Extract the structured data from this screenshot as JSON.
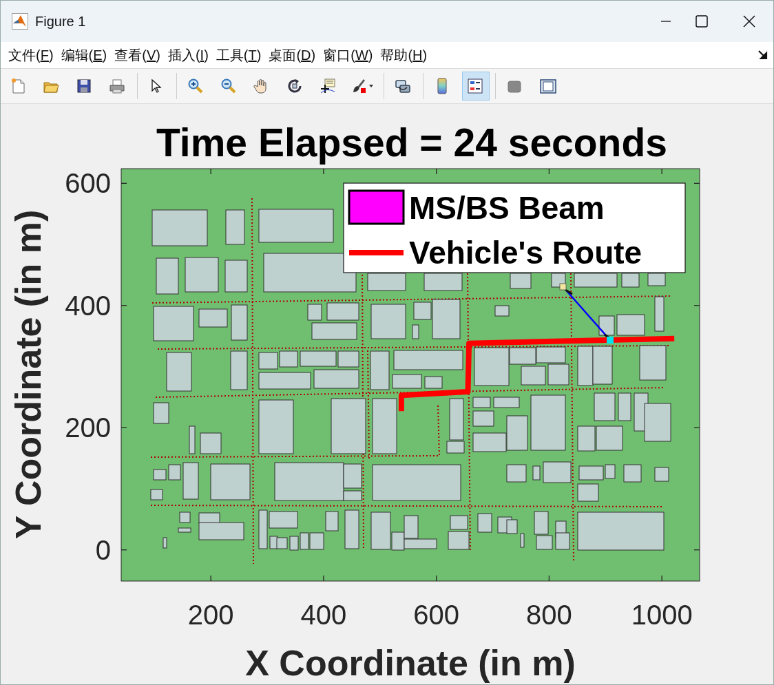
{
  "window": {
    "title": "Figure 1"
  },
  "menu": [
    {
      "label": "文件(F)"
    },
    {
      "label": "编辑(E)"
    },
    {
      "label": "查看(V)"
    },
    {
      "label": "插入(I)"
    },
    {
      "label": "工具(T)"
    },
    {
      "label": "桌面(D)"
    },
    {
      "label": "窗口(W)"
    },
    {
      "label": "帮助(H)"
    }
  ],
  "toolbar": [
    {
      "kind": "new",
      "selected": false
    },
    {
      "kind": "open",
      "selected": false
    },
    {
      "kind": "save",
      "selected": false
    },
    {
      "kind": "print",
      "selected": false
    },
    {
      "kind": "separator"
    },
    {
      "kind": "pointer",
      "selected": false
    },
    {
      "kind": "separator"
    },
    {
      "kind": "zoom-in",
      "selected": false
    },
    {
      "kind": "zoom-out",
      "selected": false
    },
    {
      "kind": "pan",
      "selected": false
    },
    {
      "kind": "rotate",
      "selected": false
    },
    {
      "kind": "data-cursor",
      "selected": false
    },
    {
      "kind": "brush",
      "selected": false
    },
    {
      "kind": "separator"
    },
    {
      "kind": "link",
      "selected": false
    },
    {
      "kind": "separator"
    },
    {
      "kind": "colorbar",
      "selected": false
    },
    {
      "kind": "legend",
      "selected": true
    },
    {
      "kind": "separator"
    },
    {
      "kind": "square",
      "selected": false
    },
    {
      "kind": "frame",
      "selected": false
    }
  ],
  "figure": {
    "legend": [
      {
        "label": "MS/BS Beam",
        "kind": "patch",
        "color": "#ff00ff"
      }
    ],
    "chart_data": {
      "type": "line",
      "title": "Time Elapsed = 24 seconds",
      "xlabel": "X Coordinate (in m)",
      "ylabel": "Y Coordinate (in m)",
      "xlim": [
        41,
        1067
      ],
      "ylim": [
        -51,
        624
      ],
      "xticks": [
        200,
        400,
        600,
        800,
        1000
      ],
      "yticks": [
        0,
        200,
        400,
        600
      ],
      "series": [
        {
          "name": "Vehicle's Route",
          "color": "#ff0000",
          "x": [
            538,
            538,
            656,
            658,
            1022
          ],
          "values": [
            227,
            253,
            259,
            338,
            346
          ]
        }
      ]
    }
  }
}
